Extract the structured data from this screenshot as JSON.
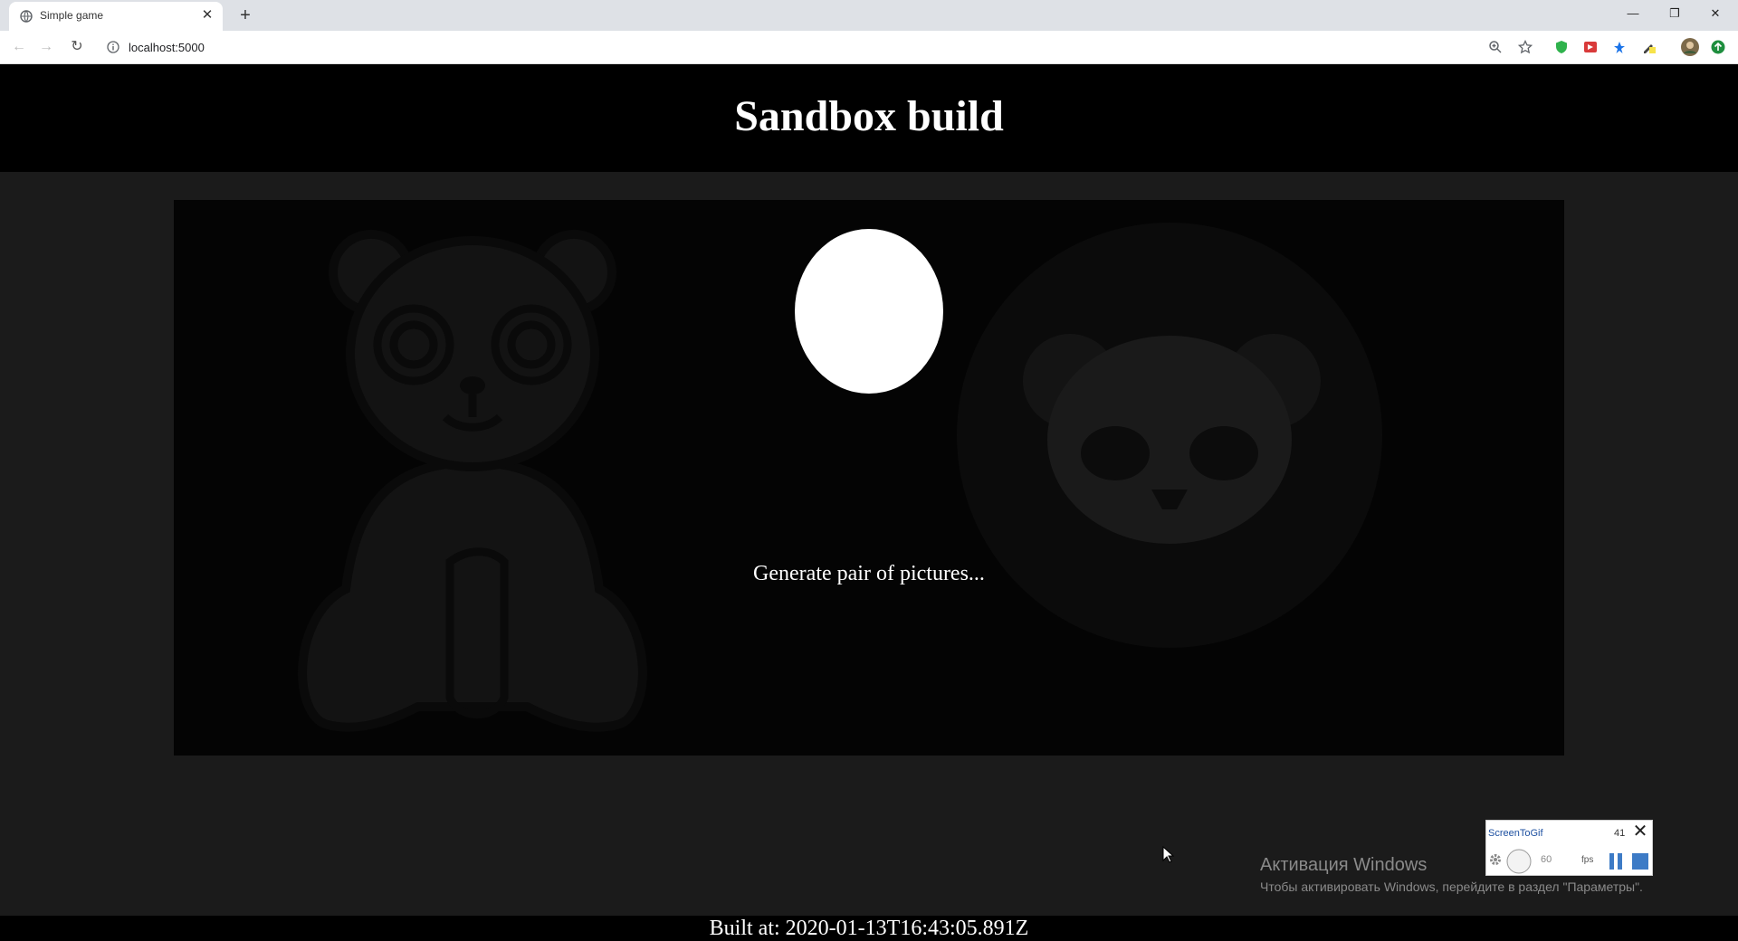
{
  "browser": {
    "tab_title": "Simple game",
    "tab_close": "✕",
    "new_tab": "+",
    "url": "localhost:5000",
    "back": "←",
    "forward": "→",
    "reload": "↻",
    "minimize": "—",
    "restore": "❐",
    "close": "✕"
  },
  "page": {
    "heading": "Sandbox build",
    "status": "Generate pair of pictures...",
    "built_at": "Built at: 2020-01-13T16:43:05.891Z"
  },
  "overlay": {
    "activation_title": "Активация Windows",
    "activation_text": "Чтобы активировать Windows, перейдите в раздел \"Параметры\".",
    "screentogif_name": "ScreenToGif",
    "screentogif_count": "41",
    "screentogif_close": "✕",
    "fps_value": "60",
    "fps_label": "fps"
  },
  "colors": {
    "page_bg": "#1b1b1b",
    "header_bg": "#000000",
    "stage_bg": "#040404",
    "accent": "#3d7bc6"
  },
  "icons": [
    "globe-icon",
    "close-icon",
    "plus-icon",
    "back-icon",
    "forward-icon",
    "reload-icon",
    "info-icon",
    "zoom-icon",
    "star-icon",
    "extension-icon",
    "profile-icon",
    "cursor-icon",
    "gear-icon",
    "pause-icon",
    "stop-icon"
  ]
}
